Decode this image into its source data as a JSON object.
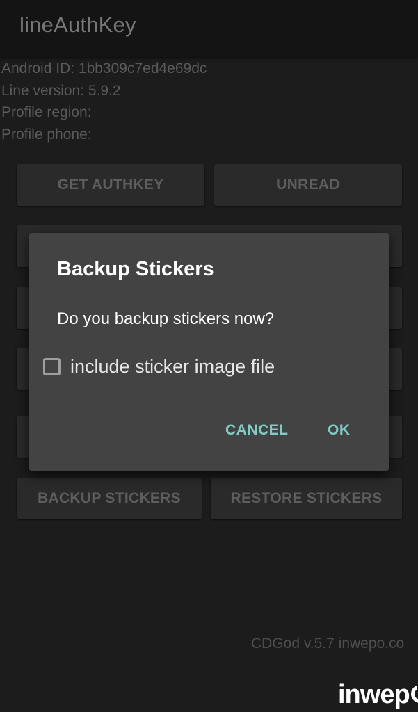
{
  "appbar": {
    "title": "lineAuthKey"
  },
  "info": {
    "android_id": "Android ID: 1bb309c7ed4e69dc",
    "line_version": "Line version: 5.9.2",
    "profile_region": "Profile region:",
    "profile_phone": "Profile phone:"
  },
  "buttons": {
    "get_authkey": "GET AUTHKEY",
    "unread": "UNREAD",
    "backup_stickers": "BACKUP STICKERS",
    "restore_stickers": "RESTORE STICKERS"
  },
  "dialog": {
    "title": "Backup Stickers",
    "message": "Do you backup stickers now?",
    "checkbox_label": "include sticker image file",
    "checkbox_checked": false,
    "cancel": "CANCEL",
    "ok": "OK"
  },
  "footer": {
    "version_text": "CDGod v.5.7 inwepo.co"
  },
  "watermark": {
    "text": "inwep"
  },
  "colors": {
    "background": "#1c1c1c",
    "dialog_bg": "#434343",
    "accent": "#80cbc4"
  }
}
